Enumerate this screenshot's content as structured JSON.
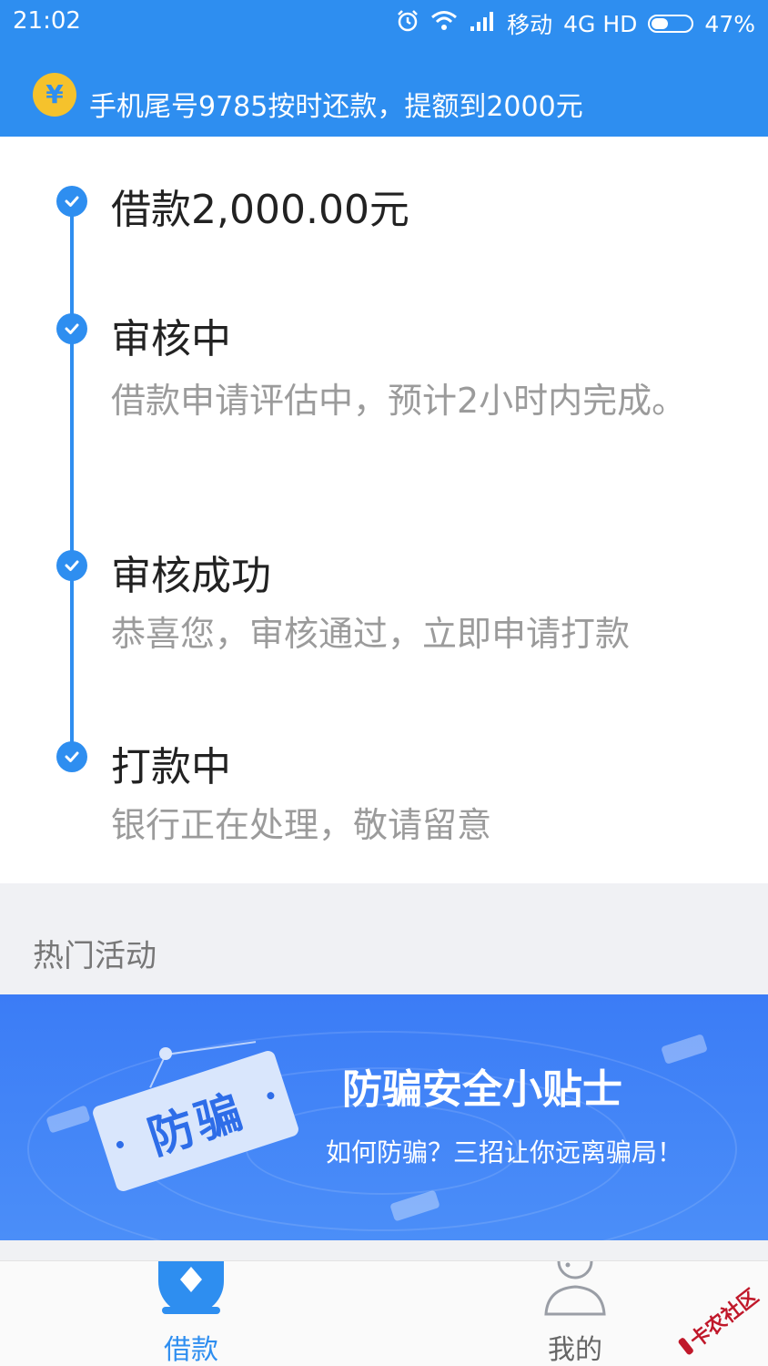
{
  "status_bar": {
    "time": "21:02",
    "carrier": "移动",
    "network": "4G HD",
    "battery": "47%",
    "icons": [
      "alarm-icon",
      "wifi-icon",
      "signal-icon",
      "battery-icon"
    ]
  },
  "notice": {
    "coin_symbol": "¥",
    "text": "手机尾号9785按时还款，提额到2000元"
  },
  "steps": [
    {
      "title": "借款2,000.00元",
      "desc": ""
    },
    {
      "title": "审核中",
      "desc": "借款申请评估中，预计2小时内完成。"
    },
    {
      "title": "审核成功",
      "desc": "恭喜您，审核通过，立即申请打款"
    },
    {
      "title": "打款中",
      "desc": "银行正在处理，敬请留意"
    }
  ],
  "hot": {
    "title": "热门活动",
    "banner": {
      "badge": "防骗",
      "title": "防骗安全小贴士",
      "subtitle": "如何防骗？三招让你远离骗局！"
    }
  },
  "bottom_nav": {
    "borrow": "借款",
    "mine": "我的"
  },
  "watermark": "卡农社区",
  "colors": {
    "primary": "#2e8ef0",
    "coin": "#f5c22c",
    "banner": "#3b7cf6",
    "watermark": "#c0182a"
  }
}
